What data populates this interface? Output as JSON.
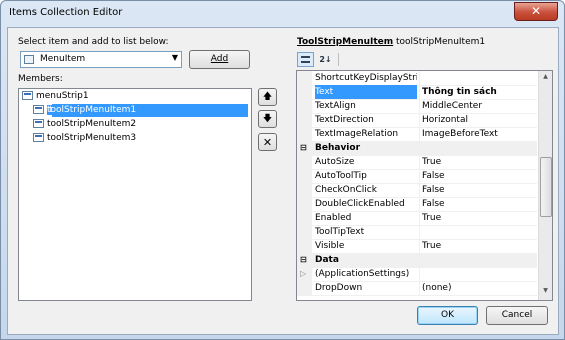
{
  "window": {
    "title": "Items Collection Editor",
    "close_glyph": "✕"
  },
  "left": {
    "select_label": "Select item and add to list below:",
    "combo_value": "MenuItem",
    "add_button": "Add",
    "members_label": "Members:",
    "tree": [
      {
        "label": "menuStrip1",
        "selected": false
      },
      {
        "label": "toolStripMenuItem1",
        "selected": true
      },
      {
        "label": "toolStripMenuItem2",
        "selected": false
      },
      {
        "label": "toolStripMenuItem3",
        "selected": false
      }
    ]
  },
  "move_buttons": {
    "up_glyph": "🡅",
    "down_glyph": "🡇",
    "delete_glyph": "✕"
  },
  "right": {
    "type_name": "ToolStripMenuItem",
    "instance_name": "toolStripMenuItem1",
    "properties": [
      {
        "name": "ShortcutKeyDisplayString",
        "value": ""
      },
      {
        "name": "Text",
        "value": "Thông tin sách",
        "highlight": true
      },
      {
        "name": "TextAlign",
        "value": "MiddleCenter"
      },
      {
        "name": "TextDirection",
        "value": "Horizontal"
      },
      {
        "name": "TextImageRelation",
        "value": "ImageBeforeText"
      },
      {
        "name": "Behavior",
        "category": true,
        "expander": "⊟"
      },
      {
        "name": "AutoSize",
        "value": "True"
      },
      {
        "name": "AutoToolTip",
        "value": "False"
      },
      {
        "name": "CheckOnClick",
        "value": "False"
      },
      {
        "name": "DoubleClickEnabled",
        "value": "False"
      },
      {
        "name": "Enabled",
        "value": "True"
      },
      {
        "name": "ToolTipText",
        "value": ""
      },
      {
        "name": "Visible",
        "value": "True"
      },
      {
        "name": "Data",
        "category": true,
        "expander": "⊟"
      },
      {
        "name": "(ApplicationSettings)",
        "value": "",
        "expander": "▷"
      },
      {
        "name": "DropDown",
        "value": "(none)"
      }
    ]
  },
  "footer": {
    "ok": "OK",
    "cancel": "Cancel"
  },
  "colors": {
    "selection": "#3399ff",
    "title_bar": "#c6d7ec"
  }
}
